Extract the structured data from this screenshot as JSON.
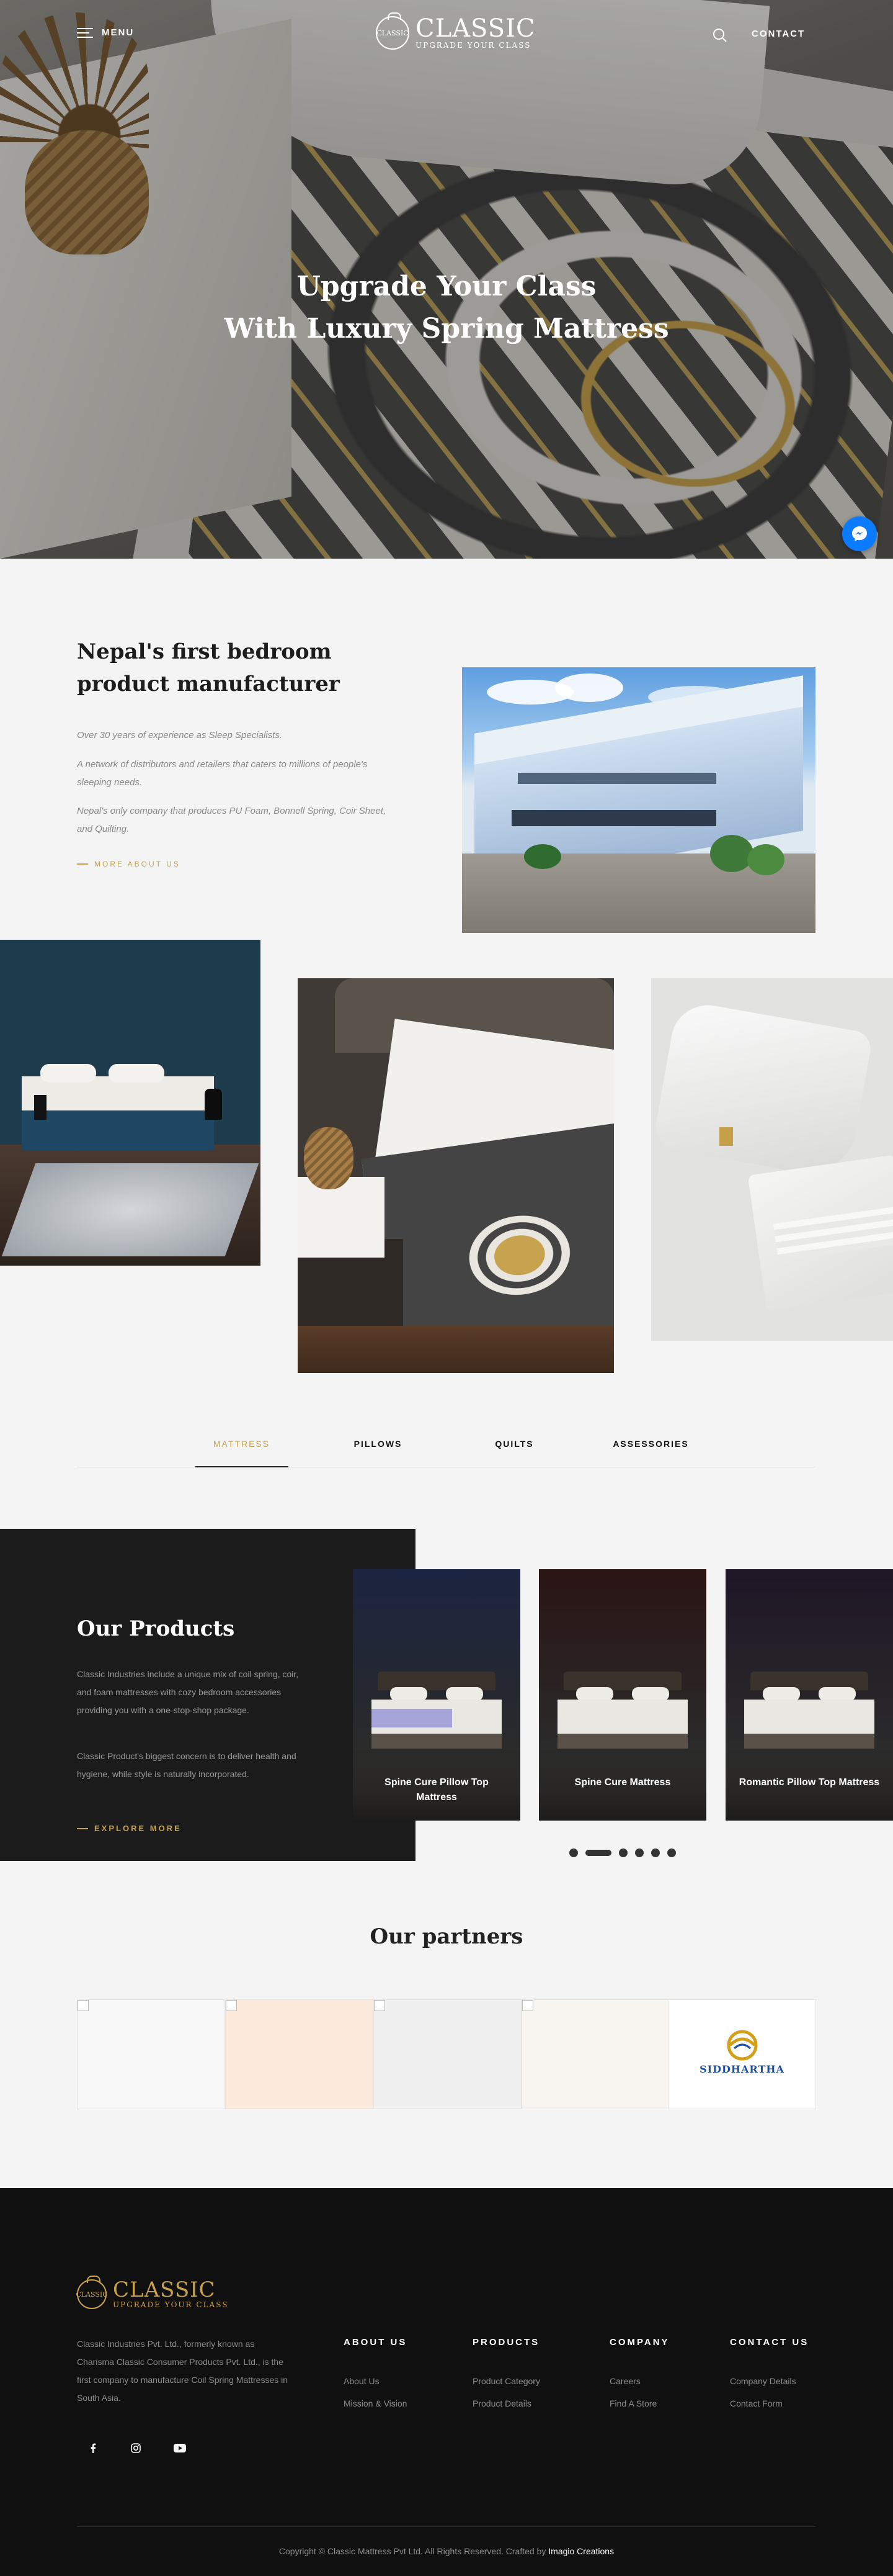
{
  "nav": {
    "menu_label": "MENU",
    "logo_text": "CLASSIC",
    "logo_tagline": "UPGRADE YOUR CLASS",
    "logo_badge_text": "CLASSIC",
    "contact_label": "CONTACT",
    "search_icon": "search-icon",
    "menu_icon": "hamburger-icon"
  },
  "hero": {
    "line1": "Upgrade Your Class",
    "line2": "With Luxury Spring Mattress",
    "messenger_icon": "messenger-icon"
  },
  "about": {
    "title": "Nepal's first bedroom product manufacturer",
    "paragraphs": [
      "Over 30 years of experience as Sleep Specialists.",
      "A network of distributors and retailers that caters to millions of people's sleeping needs.",
      "Nepal's only company that produces PU Foam, Bonnell Spring, Coir Sheet, and Quilting."
    ],
    "more_label": "MORE ABOUT US"
  },
  "tabs": [
    {
      "label": "MATTRESS",
      "active": true
    },
    {
      "label": "PILLOWS",
      "active": false
    },
    {
      "label": "QUILTS",
      "active": false
    },
    {
      "label": "ASSESSORIES",
      "active": false
    }
  ],
  "products": {
    "title": "Our Products",
    "paragraphs": [
      "Classic Industries include a unique mix of coil spring, coir, and foam mattresses with cozy bedroom accessories providing you with a one-stop-shop package.",
      "Classic Product's biggest concern is to deliver health and hygiene, while style is naturally incorporated."
    ],
    "more_label": "EXPLORE MORE",
    "cards": [
      {
        "name": "Spine Cure Pillow Top Mattress",
        "bg": "#1b2440"
      },
      {
        "name": "Spine Cure Mattress",
        "bg": "#2a1414"
      },
      {
        "name": "Romantic Pillow Top Mattress",
        "bg": "#1f1626"
      }
    ],
    "carousel_total": 6,
    "carousel_active": 2
  },
  "partners": {
    "title": "Our partners",
    "logos": [
      {
        "bg": "#f8f8f8"
      },
      {
        "bg": "#fbeadb"
      },
      {
        "bg": "#f0f0f0"
      },
      {
        "bg": "#f8f4f0"
      },
      {
        "bg": "#ffffff",
        "name": "SIDDHARTHA"
      }
    ]
  },
  "footer": {
    "logo_text": "CLASSIC",
    "logo_tagline": "UPGRADE YOUR CLASS",
    "description": "Classic Industries Pvt. Ltd., formerly known as Charisma Classic Consumer Products Pvt. Ltd., is the first company to manufacture Coil Spring Mattresses in South Asia.",
    "columns": [
      {
        "heading": "ABOUT US",
        "links": [
          "About Us",
          "Mission & Vision"
        ]
      },
      {
        "heading": "PRODUCTS",
        "links": [
          "Product Category",
          "Product Details"
        ]
      },
      {
        "heading": "COMPANY",
        "links": [
          "Careers",
          "Find A Store"
        ]
      },
      {
        "heading": "CONTACT US",
        "links": [
          "Company Details",
          "Contact Form"
        ]
      }
    ],
    "social": [
      "facebook-icon",
      "instagram-icon",
      "youtube-icon"
    ],
    "copyright": "Copyright © Classic Mattress Pvt Ltd. All Rights Reserved. Crafted by",
    "crafted_by": "Imagio Creations"
  },
  "colors": {
    "accent": "#c9a24b",
    "footer_bg": "#101010",
    "products_panel": "#1b1b1b",
    "messenger": "#0b7bff"
  }
}
